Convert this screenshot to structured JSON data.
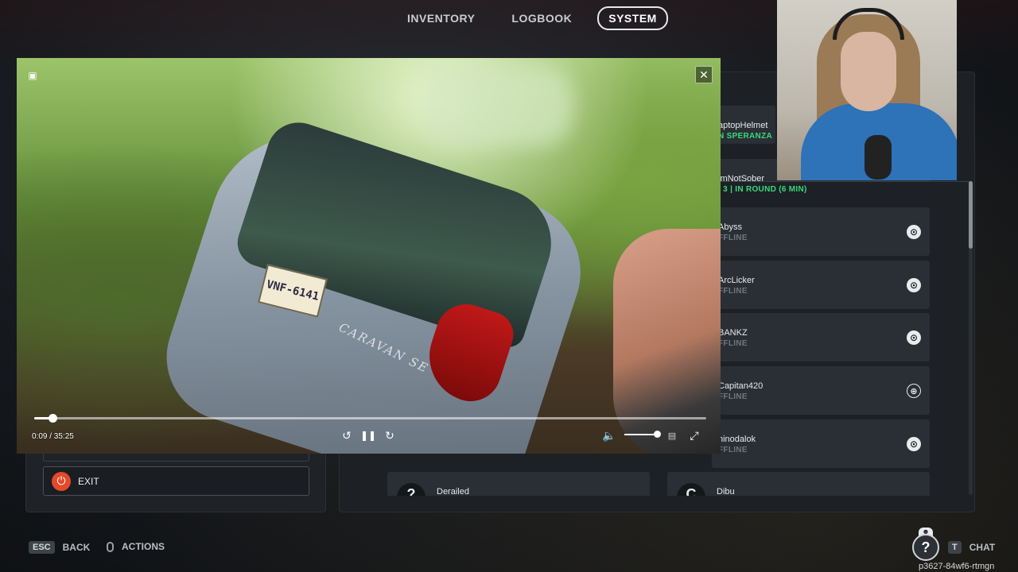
{
  "nav": {
    "tabs": [
      {
        "label": "INVENTORY"
      },
      {
        "label": "LOGBOOK"
      },
      {
        "label": "SYSTEM"
      }
    ],
    "active": "SYSTEM"
  },
  "menu": {
    "exit_label": "EXIT"
  },
  "friends": {
    "cards": [
      {
        "name": "aptopHelmet",
        "status": "N SPERANZA",
        "status_color": "green",
        "platform": "hidden"
      },
      {
        "name": "lmNotSober",
        "status": "/ 3 | IN ROUND (6 MIN)",
        "status_color": "green",
        "platform": "globe-icon"
      },
      {
        "name": "Abyss",
        "status": "FFLINE",
        "status_color": "grey",
        "platform": "steam-icon"
      },
      {
        "name": "ArcLicker",
        "status": "FFLINE",
        "status_color": "grey",
        "platform": "steam-icon"
      },
      {
        "name": "BANKZ",
        "status": "FFLINE",
        "status_color": "grey",
        "platform": "steam-icon"
      },
      {
        "name": "Capitan420",
        "status": "FFLINE",
        "status_color": "grey",
        "platform": "globe-icon"
      },
      {
        "name": "hinodalok",
        "status": "FFLINE",
        "status_color": "grey",
        "platform": "steam-icon"
      }
    ],
    "bottom": [
      {
        "name": "Derailed",
        "avatar": "?"
      },
      {
        "name": "Dibu",
        "avatar": "C"
      }
    ]
  },
  "video": {
    "plate_text": "VNF-6141",
    "badge_text": "CARAVAN SE",
    "time": "0:09 / 35:25",
    "progress_fraction": 0.027,
    "volume_fraction": 0.9
  },
  "hints": {
    "back_key": "ESC",
    "back_label": "BACK",
    "actions_label": "ACTIONS",
    "chat_key": "T",
    "chat_label": "CHAT"
  },
  "session_id": "p3627-84wf6-rtmgn",
  "colors": {
    "accent_online": "#39d97a",
    "exit_red": "#e24a2b"
  }
}
